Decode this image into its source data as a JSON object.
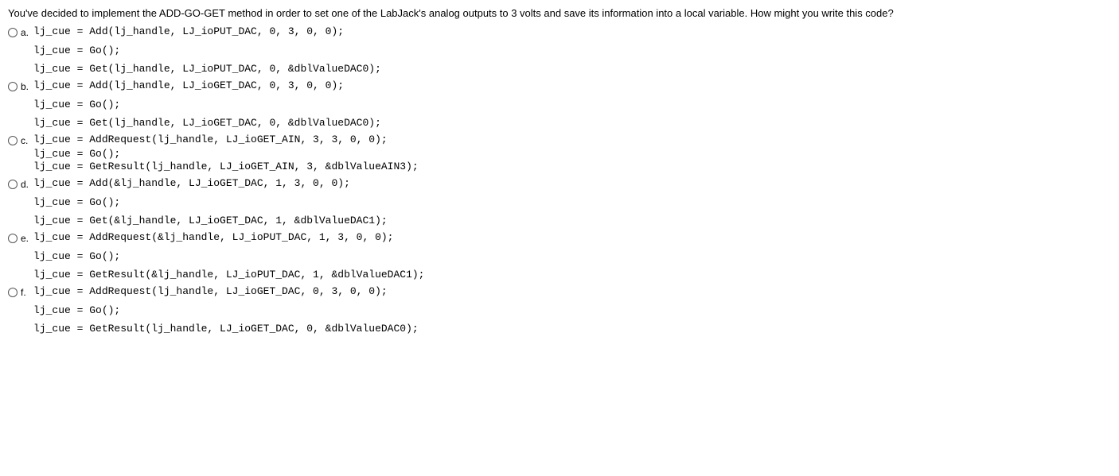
{
  "question": "You've decided to implement the ADD-GO-GET method in order to set one of the LabJack's analog outputs to 3 volts and save its information into a local variable. How might you write this code?",
  "options": {
    "a": {
      "letter": "a.",
      "line1": "lj_cue = Add(lj_handle, LJ_ioPUT_DAC, 0, 3, 0, 0);",
      "line2": "lj_cue = Go();",
      "line3": "lj_cue = Get(lj_handle, LJ_ioPUT_DAC, 0, &dblValueDAC0);"
    },
    "b": {
      "letter": "b.",
      "line1": "lj_cue = Add(lj_handle, LJ_ioGET_DAC, 0, 3, 0, 0);",
      "line2": "lj_cue = Go();",
      "line3": "lj_cue = Get(lj_handle, LJ_ioGET_DAC, 0, &dblValueDAC0);"
    },
    "c": {
      "letter": "c.",
      "line1": "lj_cue = AddRequest(lj_handle, LJ_ioGET_AIN, 3, 3, 0, 0);",
      "line2": "lj_cue = Go();",
      "line3": "lj_cue = GetResult(lj_handle, LJ_ioGET_AIN, 3, &dblValueAIN3);"
    },
    "d": {
      "letter": "d.",
      "line1": "lj_cue = Add(&lj_handle, LJ_ioGET_DAC, 1, 3, 0, 0);",
      "line2": "lj_cue = Go();",
      "line3": "lj_cue = Get(&lj_handle, LJ_ioGET_DAC, 1, &dblValueDAC1);"
    },
    "e": {
      "letter": "e.",
      "line1": "lj_cue = AddRequest(&lj_handle, LJ_ioPUT_DAC, 1, 3, 0, 0);",
      "line2": "lj_cue = Go();",
      "line3": "lj_cue = GetResult(&lj_handle, LJ_ioPUT_DAC, 1, &dblValueDAC1);"
    },
    "f": {
      "letter": "f.",
      "line1": "lj_cue = AddRequest(lj_handle, LJ_ioGET_DAC, 0, 3, 0, 0);",
      "line2": "lj_cue = Go();",
      "line3": "lj_cue = GetResult(lj_handle, LJ_ioGET_DAC, 0, &dblValueDAC0);"
    }
  }
}
